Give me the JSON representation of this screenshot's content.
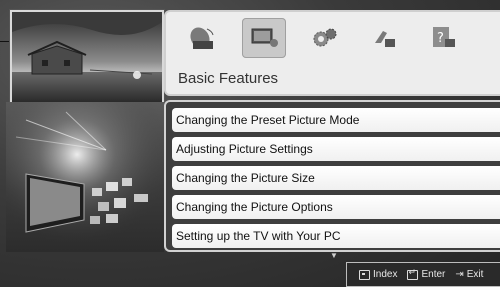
{
  "header": {
    "title": "Basic Features",
    "tabs": [
      {
        "icon": "satellite-dish-icon"
      },
      {
        "icon": "tv-screen-icon",
        "selected": true
      },
      {
        "icon": "gears-icon"
      },
      {
        "icon": "hand-pointer-icon"
      },
      {
        "icon": "help-question-icon"
      }
    ]
  },
  "menu": {
    "items": [
      "Changing the Preset Picture Mode",
      "Adjusting Picture Settings",
      "Changing the Picture Size",
      "Changing the Picture Options",
      "Setting up the TV with Your PC"
    ]
  },
  "footer": {
    "index_label": "Index",
    "enter_label": "Enter",
    "exit_label": "Exit"
  },
  "colors": {
    "background": "#2f2f2f",
    "panel": "#ededed",
    "selected_tab": "#c9c9c9"
  }
}
